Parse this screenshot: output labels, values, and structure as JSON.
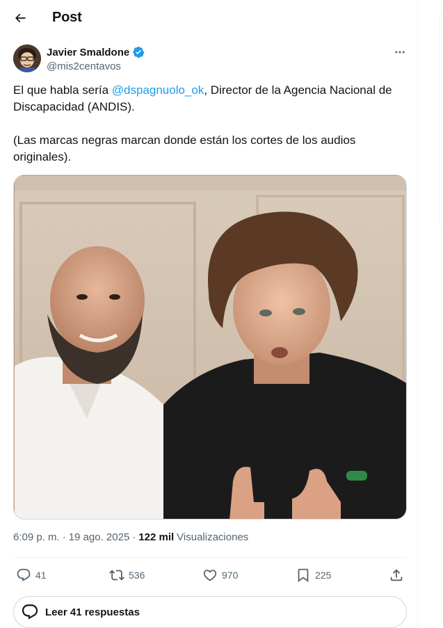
{
  "header": {
    "title": "Post"
  },
  "author": {
    "name": "Javier Smaldone",
    "handle": "@mis2centavos"
  },
  "tweet": {
    "before_mention": "El que habla sería ",
    "mention": "@dspagnuolo_ok",
    "after_mention": ", Director de la Agencia Nacional de Discapacidad (ANDIS).",
    "second_paragraph": "(Las marcas negras marcan donde están los cortes de los audios originales)."
  },
  "meta": {
    "time": "6:09 p. m.",
    "separator": "·",
    "date": "19 ago. 2025",
    "views_count": "122 mil",
    "views_label": "Visualizaciones"
  },
  "actions": {
    "replies": "41",
    "reposts": "536",
    "likes": "970",
    "bookmarks": "225"
  },
  "read_replies": "Leer 41 respuestas",
  "colors": {
    "accent": "#1d9bf0",
    "text": "#0f1419",
    "muted": "#536471",
    "border": "#cfd9de"
  }
}
